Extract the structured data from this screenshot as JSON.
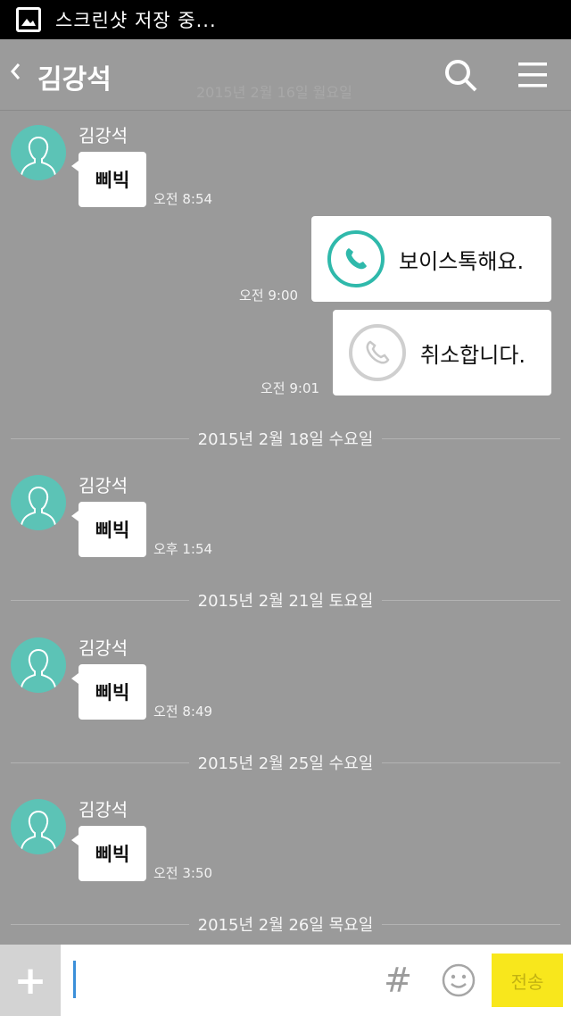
{
  "status_bar": {
    "text": "스크린샷 저장 중..."
  },
  "header": {
    "title": "김강석",
    "watermark": "2015년 2월 16일 월요일"
  },
  "messages": [
    {
      "sender": "김강석",
      "text": "삐빅",
      "time": "오전 8:54"
    },
    {
      "sender": "김강석",
      "text": "삐빅",
      "time": "오후 1:54"
    },
    {
      "sender": "김강석",
      "text": "삐빅",
      "time": "오전 8:49"
    },
    {
      "sender": "김강석",
      "text": "삐빅",
      "time": "오전 3:50"
    }
  ],
  "calls": [
    {
      "text": "보이스톡해요.",
      "time": "오전 9:00"
    },
    {
      "text": "취소합니다.",
      "time": "오전 9:01"
    }
  ],
  "dates": [
    "2015년 2월 18일 수요일",
    "2015년 2월 21일 토요일",
    "2015년 2월 25일 수요일",
    "2015년 2월 26일 목요일"
  ],
  "input": {
    "value": "",
    "send_label": "전송",
    "plus_label": "+",
    "hash_label": "#"
  },
  "colors": {
    "accent": "#2fb9ab",
    "send": "#f8e71c",
    "avatar": "#5cc3b6"
  }
}
